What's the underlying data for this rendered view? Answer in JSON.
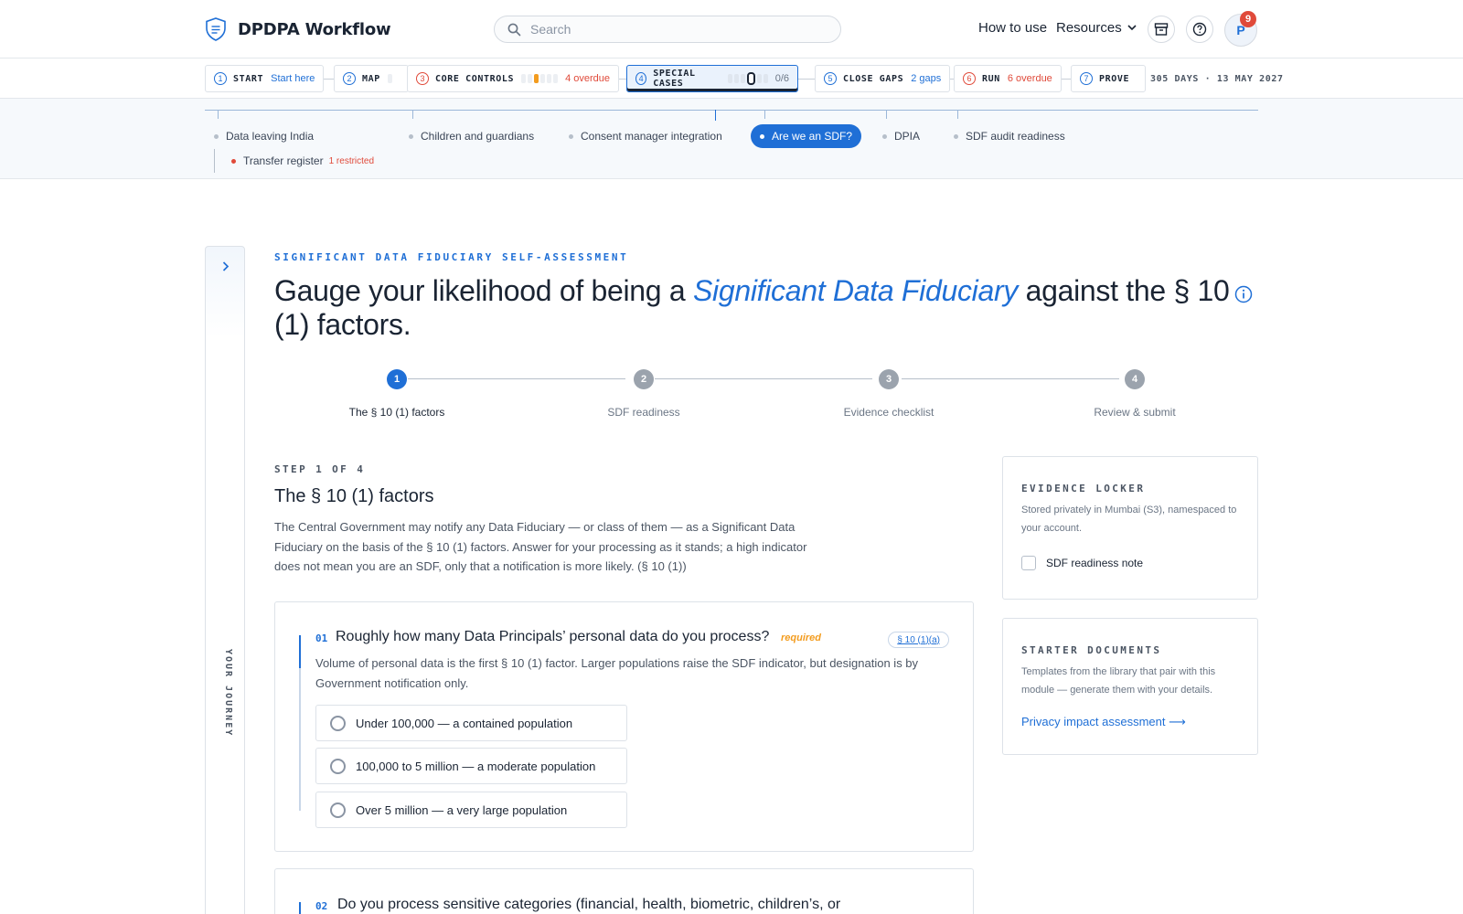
{
  "app": {
    "name": "DPDPA Workflow",
    "search_placeholder": "Search",
    "nav": {
      "how_to_use": "How to use",
      "resources": "Resources"
    },
    "avatar_initial": "P",
    "notification_count": "9",
    "accent_color": "#1f6fd6",
    "alert_color": "#e04a3a"
  },
  "stages": [
    {
      "num": "1",
      "label": "START",
      "sub": "Start here",
      "status": "normal"
    },
    {
      "num": "2",
      "label": "MAP",
      "sub": "",
      "status": "normal"
    },
    {
      "num": "3",
      "label": "CORE CONTROLS",
      "sub": "4 overdue",
      "status": "overdue"
    },
    {
      "num": "4",
      "label": "SPECIAL CASES",
      "sub": "0/6",
      "status": "active"
    },
    {
      "num": "5",
      "label": "CLOSE GAPS",
      "sub": "2 gaps",
      "status": "normal"
    },
    {
      "num": "6",
      "label": "RUN",
      "sub": "6 overdue",
      "status": "overdue"
    },
    {
      "num": "7",
      "label": "PROVE",
      "sub": "",
      "status": "normal"
    }
  ],
  "deadline": "305 DAYS · 13 MAY 2027",
  "subnav": {
    "items": [
      "Data leaving India",
      "Children and guardians",
      "Consent manager integration",
      "Are we an SDF?",
      "DPIA",
      "SDF audit readiness"
    ],
    "active_index": 3,
    "child": {
      "label": "Transfer register",
      "note": "1 restricted"
    }
  },
  "journey": {
    "label": "YOUR JOURNEY"
  },
  "page": {
    "eyebrow": "SIGNIFICANT DATA FIDUCIARY SELF-ASSESSMENT",
    "headline_pre": "Gauge your likelihood of being a",
    "headline_em": "Significant Data Fiduciary",
    "headline_post": "against the § 10 (1) factors."
  },
  "stepper": {
    "current": 1,
    "steps": [
      {
        "num": "1",
        "label": "The § 10 (1) factors"
      },
      {
        "num": "2",
        "label": "SDF readiness"
      },
      {
        "num": "3",
        "label": "Evidence checklist"
      },
      {
        "num": "4",
        "label": "Review & submit"
      }
    ]
  },
  "step": {
    "eyebrow": "STEP 1 OF 4",
    "title": "The § 10 (1) factors",
    "description": "The Central Government may notify any Data Fiduciary — or class of them — as a Significant Data Fiduciary on the basis of the § 10 (1) factors. Answer for your processing as it stands; a high indicator does not mean you are an SDF, only that a notification is more likely. (§ 10 (1))"
  },
  "questions": [
    {
      "num": "01",
      "title": "Roughly how many Data Principals’ personal data do you process?",
      "required": "required",
      "ref": "§ 10 (1)(a)",
      "description": "Volume of personal data is the first § 10 (1) factor. Larger populations raise the SDF indicator, but designation is by Government notification only.",
      "options": [
        "Under 100,000 — a contained population",
        "100,000 to 5 million — a moderate population",
        "Over 5 million — a very large population"
      ]
    },
    {
      "num": "02",
      "title": "Do you process sensitive categories (financial, health, biometric, children’s, or"
    }
  ],
  "sidebar": {
    "evidence": {
      "title": "EVIDENCE LOCKER",
      "description": "Stored privately in Mumbai (S3), namespaced to your account.",
      "item": "SDF readiness note"
    },
    "starter": {
      "title": "STARTER DOCUMENTS",
      "description": "Templates from the library that pair with this module — generate them with your details.",
      "link": "Privacy impact assessment ⟶"
    }
  }
}
